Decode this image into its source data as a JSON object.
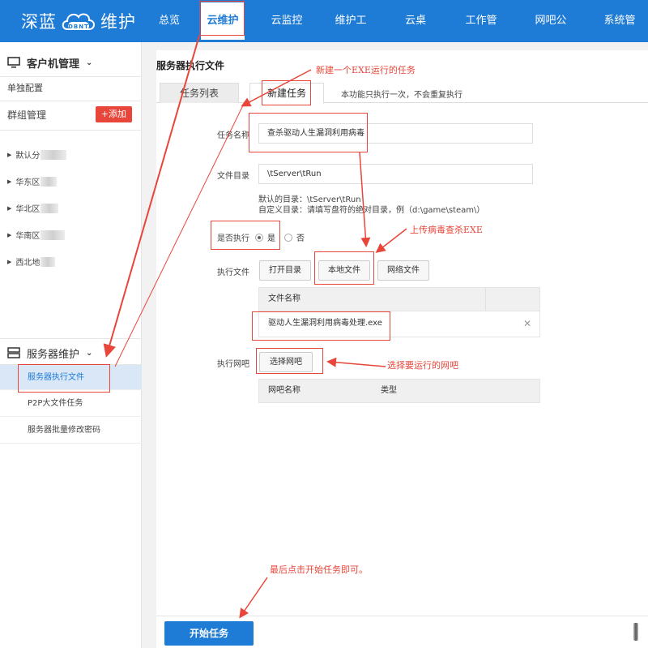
{
  "brand": {
    "left": "深蓝",
    "badge": "DBNT",
    "right": "维护"
  },
  "nav": [
    "总览",
    "云维护",
    "云监控",
    "维护工具",
    "云桌面",
    "工作管理",
    "网吧公告",
    "系统管理"
  ],
  "nav_active_index": 1,
  "sidebar": {
    "client_title": "客户机管理",
    "single_config": "单独配置",
    "group_manage": "群组管理",
    "add_label": "+添加",
    "groups": [
      "默认分",
      "华东区",
      "华北区",
      "华南区",
      "西北地"
    ],
    "server_title": "服务器维护",
    "server_items": [
      "服务器执行文件",
      "P2P大文件任务",
      "服务器批量修改密码"
    ]
  },
  "main": {
    "title": "服务器执行文件",
    "tab_list": "任务列表",
    "tab_new": "新建任务",
    "tab_note": "本功能只执行一次，不会重复执行",
    "task_name_label": "任务名称",
    "task_name_value": "查杀驱动人生漏洞利用病毒",
    "file_dir_label": "文件目录",
    "file_dir_value": "\\tServer\\tRun",
    "hint_default": "默认的目录：\\tServer\\tRun",
    "hint_custom": "自定义目录：请填写盘符的绝对目录，例（d:\\game\\steam\\）",
    "execute_label": "是否执行",
    "yes": "是",
    "no": "否",
    "exec_file_label": "执行文件",
    "btn_open_dir": "打开目录",
    "btn_local_file": "本地文件",
    "btn_network_file": "网络文件",
    "file_table_header": "文件名称",
    "file_row": "驱动人生漏洞利用病毒处理.exe",
    "remove_icon": "✕",
    "exec_netbar_label": "执行网吧",
    "btn_select_netbar": "选择网吧",
    "netbar_col_name": "网吧名称",
    "netbar_col_type": "类型",
    "start_button": "开始任务"
  },
  "annotations": {
    "new_exe_task": "新建一个EXE运行的任务",
    "upload_exe": "上传病毒查杀EXE",
    "select_netbar": "选择要运行的网吧",
    "finally_start": "最后点击开始任务即可。"
  },
  "colors": {
    "primary": "#1e7bd6",
    "danger": "#e8463a",
    "annotation": "#e8463a"
  }
}
